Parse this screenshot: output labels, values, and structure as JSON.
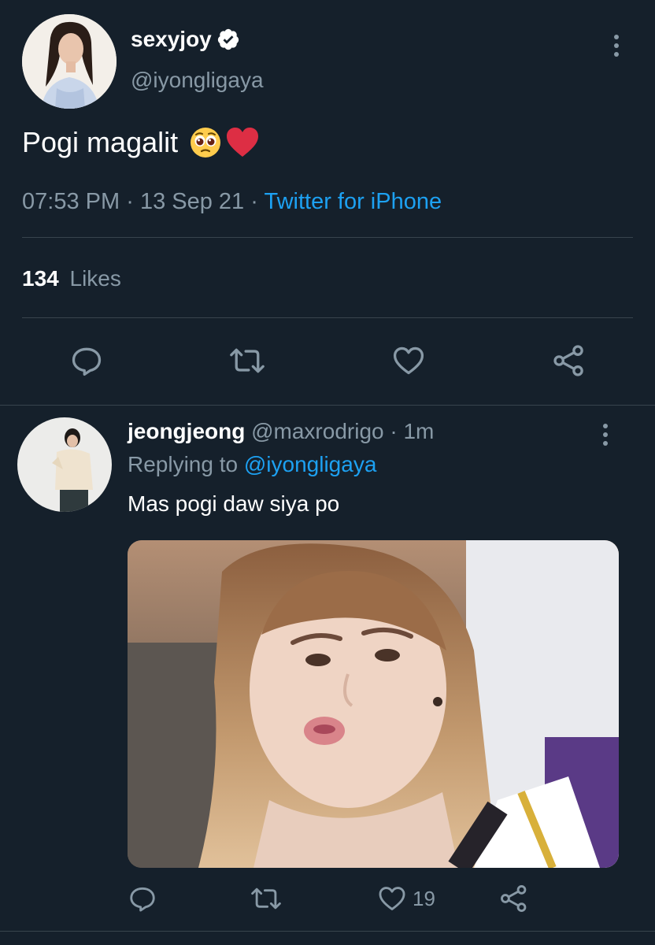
{
  "tweet": {
    "author_name": "sexyjoy",
    "handle": "@iyongligaya",
    "text": "Pogi magalit",
    "time": "07:53 PM",
    "sep1": "·",
    "date": "13 Sep 21",
    "sep2": "·",
    "source": "Twitter for iPhone",
    "likes_count": "134",
    "likes_label": "Likes"
  },
  "reply": {
    "author_name": "jeongjeong",
    "handle": "@maxrodrigo",
    "sep": "·",
    "time": "1m",
    "replying_label": "Replying to",
    "replying_handle": "@iyongligaya",
    "text": "Mas pogi daw siya po",
    "like_count": "19"
  },
  "colors": {
    "background": "#15202b",
    "divider": "#38444d",
    "muted": "#8899a6",
    "accent": "#1da1f2"
  },
  "icons": {
    "verified": "verified-badge-icon",
    "more": "more-vertical-icon",
    "reply": "reply-icon",
    "retweet": "retweet-icon",
    "like": "heart-icon",
    "share": "share-icon",
    "emoji_1": "pleading-face-emoji",
    "emoji_2": "red-heart-emoji"
  }
}
